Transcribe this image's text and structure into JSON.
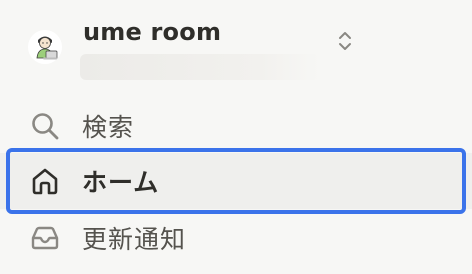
{
  "workspace": {
    "name": "ume room",
    "avatar_icon": "person-with-laptop-icon",
    "switcher_icon": "chevron-up-down-icon"
  },
  "nav": {
    "items": [
      {
        "label": "検索",
        "icon": "search-icon",
        "active": false
      },
      {
        "label": "ホーム",
        "icon": "home-icon",
        "active": true
      },
      {
        "label": "更新通知",
        "icon": "inbox-icon",
        "active": false
      }
    ]
  },
  "colors": {
    "focus_ring": "#3b73ea",
    "sidebar_bg": "#f7f7f5",
    "active_bg": "#efefed",
    "text": "#37352f"
  }
}
